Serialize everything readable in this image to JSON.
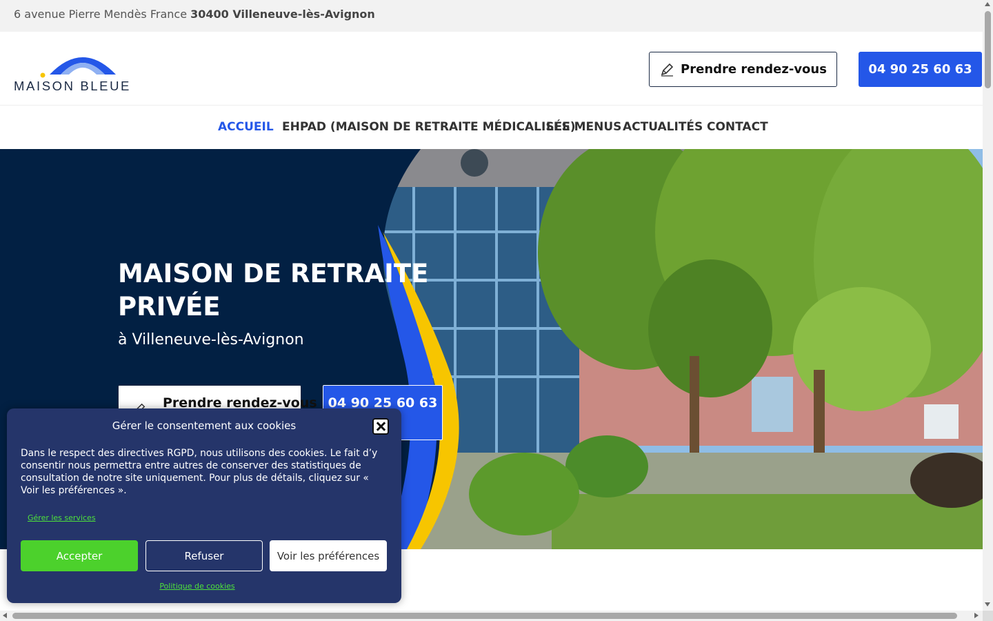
{
  "topbar": {
    "address_street": "6 avenue Pierre Mendès France",
    "address_city": "30400 Villeneuve-lès-Avignon"
  },
  "header": {
    "logo_text": "MAISON BLEUE",
    "rdv_button": "Prendre rendez-vous",
    "phone_button": "04 90 25 60 63"
  },
  "nav": {
    "items": [
      {
        "label": "ACCUEIL",
        "active": true
      },
      {
        "label": "EHPAD (MAISON DE RETRAITE MÉDICALISÉE)",
        "active": false
      },
      {
        "label": "LES MENUS",
        "active": false
      },
      {
        "label": "ACTUALITÉS",
        "active": false
      },
      {
        "label": "CONTACT",
        "active": false
      }
    ]
  },
  "hero": {
    "title": "MAISON DE RETRAITE PRIVÉE",
    "subtitle": "à Villeneuve-lès-Avignon",
    "rdv_button": "Prendre rendez-vous",
    "phone_button": "04 90 25 60 63"
  },
  "cookie": {
    "title": "Gérer le consentement aux cookies",
    "text": "Dans le respect des directives RGPD, nous utilisons des cookies. Le fait d’y consentir nous permettra entre autres de conserver des statistiques de consultation de notre site uniquement. Pour plus de détails, cliquez sur « Voir les préférences ».",
    "manage_link": "Gérer les services",
    "accept": "Accepter",
    "refuse": "Refuser",
    "preferences": "Voir les préférences",
    "policy_link": "Politique de cookies"
  },
  "colors": {
    "brand_blue": "#2457e8",
    "hero_navy": "#022043",
    "cookie_bg": "#25356a",
    "accept_green": "#4cd12c",
    "accent_yellow": "#f7c500"
  },
  "icons": {
    "rdv_icon": "pencil-icon",
    "close_icon": "close-icon"
  }
}
